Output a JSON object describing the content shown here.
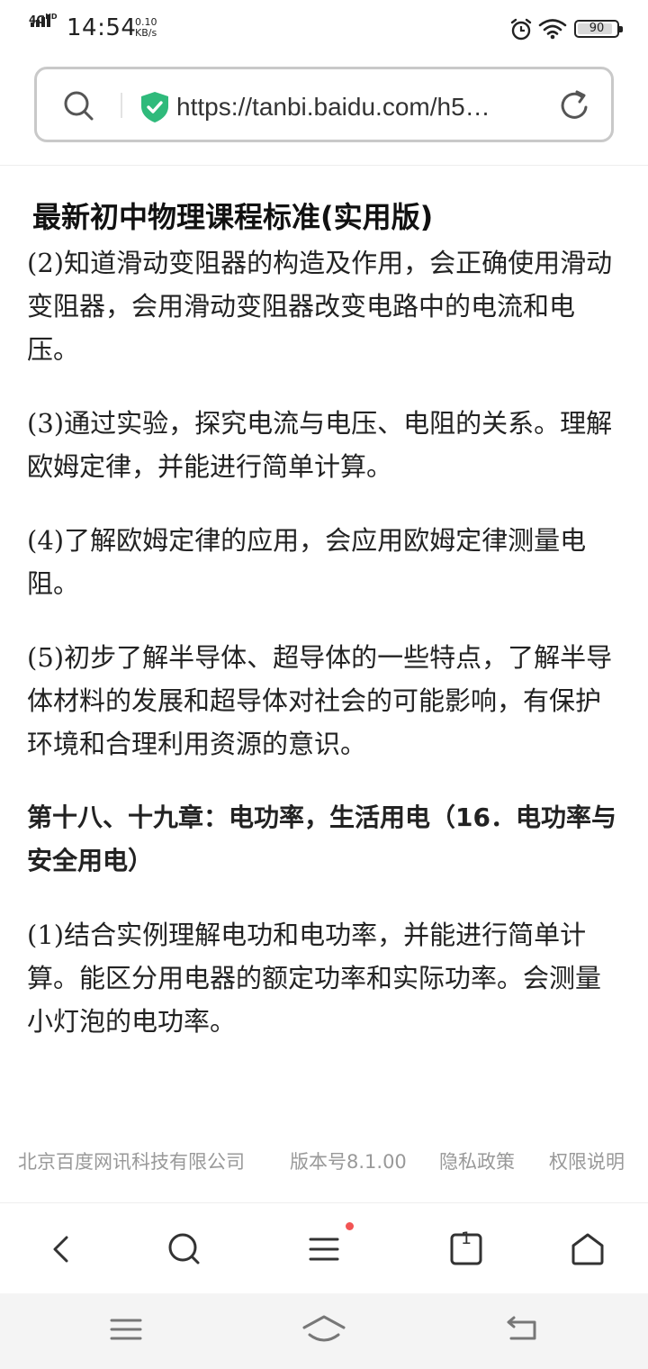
{
  "status_bar": {
    "network": "4G",
    "network_sup": "HD",
    "time": "14:54",
    "speed_value": "0.10",
    "speed_unit": "KB/s",
    "battery": "90",
    "battery_level_percent": 90
  },
  "address_bar": {
    "url": "https://tanbi.baidu.com/h5…"
  },
  "article": {
    "title": "最新初中物理课程标准(实用版)",
    "paragraphs": [
      "(2)知道滑动变阻器的构造及作用，会正确使用滑动变阻器，会用滑动变阻器改变电路中的电流和电压。",
      "(3)通过实验，探究电流与电压、电阻的关系。理解欧姆定律，并能进行简单计算。",
      "(4)了解欧姆定律的应用，会应用欧姆定律测量电阻。",
      "(5)初步了解半导体、超导体的一些特点，了解半导体材料的发展和超导体对社会的可能影响，有保护环境和合理利用资源的意识。",
      "第十八、十九章：电功率，生活用电（16．电功率与安全用电）",
      "(1)结合实例理解电功和电功率，并能进行简单计算。能区分用电器的额定功率和实际功率。会测量小灯泡的电功率。"
    ]
  },
  "footer": {
    "company": "北京百度网讯科技有限公司",
    "version": "版本号8.1.00",
    "privacy": "隐私政策",
    "permissions": "权限说明"
  },
  "toolbar": {
    "tab_count": "1",
    "menu_has_notification": true,
    "icons": [
      "back-icon",
      "search-icon",
      "menu-icon",
      "tabs-icon",
      "home-icon"
    ]
  },
  "system_nav": {
    "icons": [
      "recent-apps-icon",
      "home-icon",
      "back-icon"
    ]
  },
  "colors": {
    "shield": "#2fba7b",
    "notification_dot": "#f25454",
    "footer_text": "#999999"
  }
}
